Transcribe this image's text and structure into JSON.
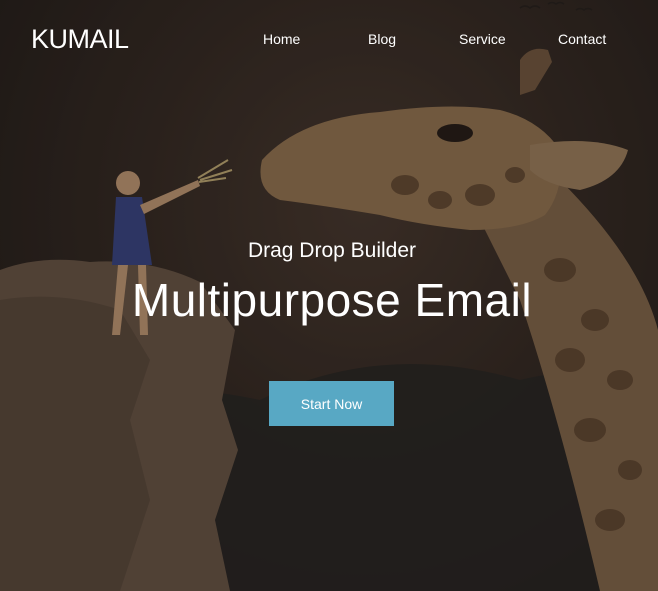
{
  "brand": {
    "name": "KUMAIL"
  },
  "nav": {
    "items": [
      {
        "label": "Home"
      },
      {
        "label": "Blog"
      },
      {
        "label": "Service"
      },
      {
        "label": "Contact"
      }
    ]
  },
  "hero": {
    "subtitle": "Drag Drop Builder",
    "headline": "Multipurpose Email",
    "cta_label": "Start Now",
    "background_image": "child-feeding-giraffe-photo"
  },
  "colors": {
    "cta_background": "#58a8c4",
    "text": "#ffffff",
    "background_dark": "#2a2420"
  }
}
